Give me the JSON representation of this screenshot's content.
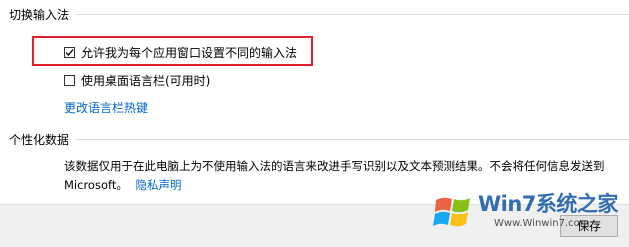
{
  "switch_input": {
    "header": "切换输入法",
    "option_per_app": {
      "label": "允许我为每个应用窗口设置不同的输入法",
      "checked": true
    },
    "option_desktop_bar": {
      "label": "使用桌面语言栏(可用时)",
      "checked": false
    },
    "hotkey_link": "更改语言栏热键"
  },
  "personalization": {
    "header": "个性化数据",
    "description_line1": "该数据仅用于在此电脑上为不使用输入法的语言来改进手写识别以及文本预测结果。不会将任何信息发送到",
    "description_prefix": "Microsoft。",
    "privacy_link": "隐私声明"
  },
  "footer": {
    "save_label": "保存"
  },
  "watermark": {
    "brand": "Win7系统之家",
    "url": "Www.Winwin7.com"
  },
  "colors": {
    "highlight": "#e0202a",
    "link": "#0066cc"
  }
}
